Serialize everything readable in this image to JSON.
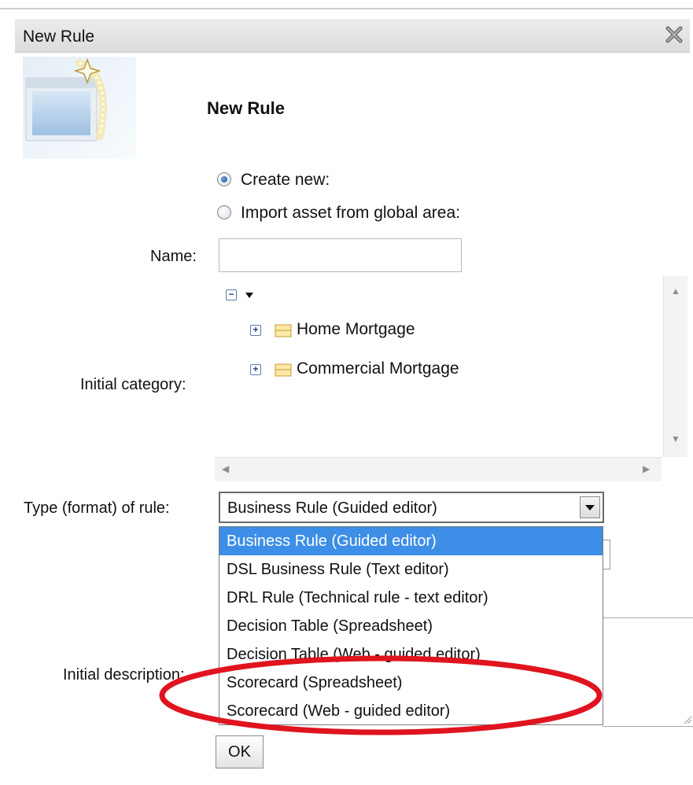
{
  "dialog": {
    "title": "New Rule",
    "header_title": "New Rule"
  },
  "radio_options": {
    "create_new": {
      "label": "Create new:",
      "checked": true
    },
    "import_global": {
      "label": "Import asset from global area:",
      "checked": false
    }
  },
  "fields": {
    "name_label": "Name:",
    "name_value": "",
    "initial_category_label": "Initial category:",
    "type_label": "Type (format) of rule:",
    "initial_description_label": "Initial description:"
  },
  "category_tree": {
    "items": [
      {
        "label": "Home Mortgage"
      },
      {
        "label": "Commercial Mortgage"
      }
    ]
  },
  "type_select": {
    "selected": "Business Rule (Guided editor)",
    "options": [
      "Business Rule (Guided editor)",
      "DSL Business Rule (Text editor)",
      "DRL Rule (Technical rule - text editor)",
      "Decision Table (Spreadsheet)",
      "Decision Table (Web - guided editor)",
      "Scorecard (Spreadsheet)",
      "Scorecard (Web - guided editor)"
    ]
  },
  "buttons": {
    "ok": "OK"
  },
  "annotation": {
    "color": "#e0141e",
    "highlights": [
      "Scorecard (Spreadsheet)",
      "Scorecard (Web - guided editor)"
    ]
  },
  "colors": {
    "selected_option_bg": "#3d8ee6",
    "titlebar": "#dcdcdc"
  }
}
